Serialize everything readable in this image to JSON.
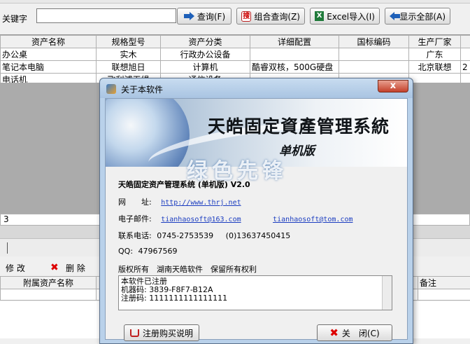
{
  "toolbar": {
    "keyword_label": "关键字",
    "keyword_value": "",
    "query_label": "查询(F)",
    "combined_query_label": "组合查询(Z)",
    "excel_import_label": "Excel导入(I)",
    "show_all_label": "显示全部(A)"
  },
  "main_table": {
    "columns": [
      "资产名称",
      "规格型号",
      "资产分类",
      "详细配置",
      "国标编码",
      "生产厂家"
    ],
    "rows": [
      [
        "办公桌",
        "实木",
        "行政办公设备",
        "",
        "",
        "广东"
      ],
      [
        "笔记本电脑",
        "联想旭日",
        "计算机",
        "酷睿双核，500G硬盘",
        "",
        "北京联想"
      ],
      [
        "电话机",
        "飞利浦无绳",
        "通信设备",
        "",
        "",
        ""
      ]
    ],
    "extra_cell": "2"
  },
  "status": {
    "count": "3"
  },
  "sub_toolbar": {
    "edit": "修 改",
    "delete": "删 除"
  },
  "sub_table": {
    "columns": [
      "附属资产名称",
      "备注"
    ]
  },
  "dialog": {
    "title": "关于本软件",
    "close_glyph": "x",
    "banner_title": "天皓固定資產管理系統",
    "banner_edition": "单机版",
    "watermark": "绿色先锋",
    "product_name": "天皓固定资产管理系统 (单机版) V2.0",
    "website_label": "网　　址:",
    "website": "http://www.thrj.net",
    "email_label": "电子邮件:",
    "email1": "tianhaosoft@163.com",
    "email2": "tianhaosoft@tom.com",
    "phone_label": "联系电话:",
    "phone": "0745-2753539",
    "mobile": "(0)13637450415",
    "qq_label": "QQ:",
    "qq": "47967569",
    "copyright": "版权所有　湖南天皓软件　保留所有权利",
    "reg_line1": "本软件已注册",
    "reg_line2": "机器码: 3839-F8F7-B12A",
    "reg_line3": "注册码: 1111111111111111",
    "buy_button": "注册购买说明",
    "close_button": "关　闭(C)"
  }
}
